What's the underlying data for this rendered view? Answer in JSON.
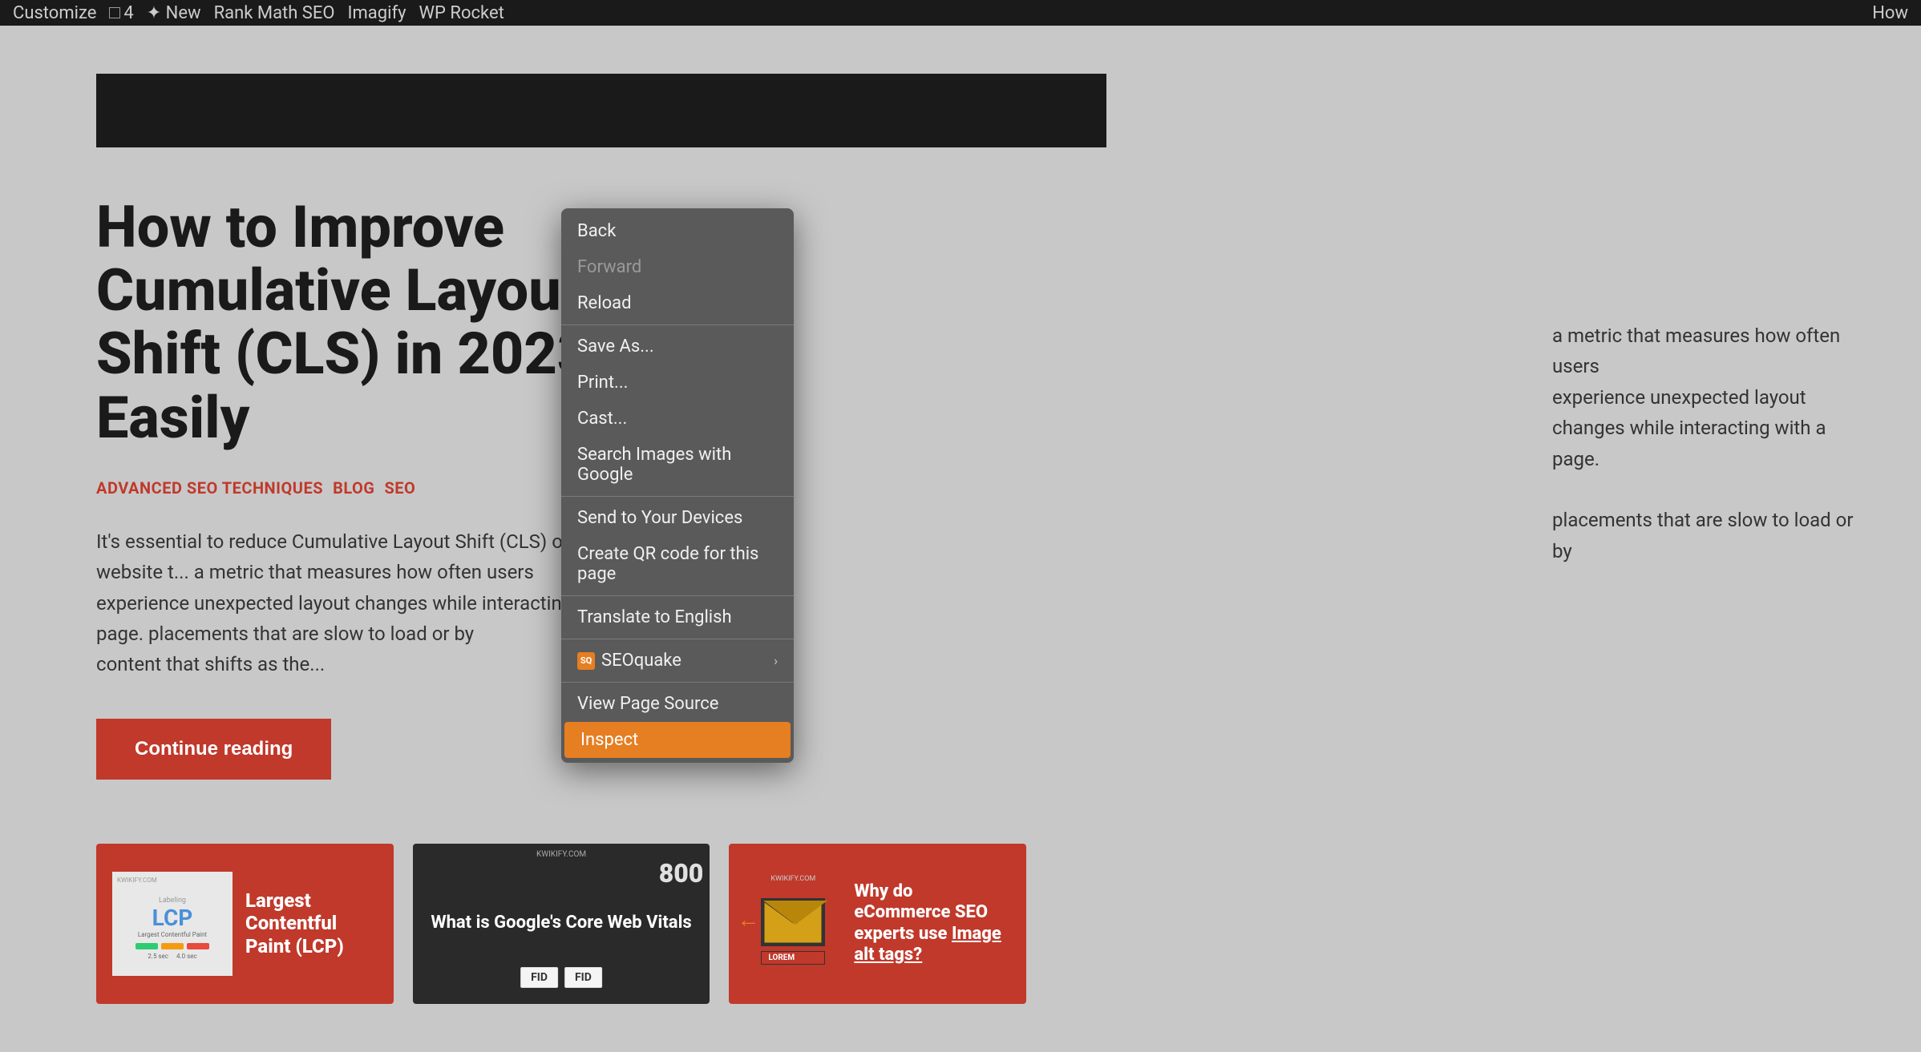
{
  "topbar": {
    "items": [
      "Customize",
      "4",
      "New",
      "Rank Math SEO",
      "Imagify",
      "WP Rocket",
      "How"
    ]
  },
  "article": {
    "title": "How to Improve Cumulative Layout Shift (CLS) in 2023 Easily",
    "tags": [
      "ADVANCED SEO TECHNIQUES",
      "BLOG",
      "SEO"
    ],
    "excerpt": "It's essential to reduce Cumulative Layout Shift (CLS) on your website t... a metric that measures how often users experience unexpected layout changes while interacting with a page... placements that are slow to load or by content that shifts as the...",
    "excerpt_short": "It's essential to reduce Cumulative Layout Shift (CLS) on your website t...",
    "excerpt_mid": "a metric that measures how often users experience unexpected layout changes while interacting with a page...",
    "excerpt_end": "placements that are slow to load or by content that shifts as the...",
    "continue_button": "Continue reading"
  },
  "context_menu": {
    "items": [
      {
        "label": "Back",
        "disabled": false,
        "has_submenu": false,
        "highlighted": false
      },
      {
        "label": "Forward",
        "disabled": true,
        "has_submenu": false,
        "highlighted": false
      },
      {
        "label": "Reload",
        "disabled": false,
        "has_submenu": false,
        "highlighted": false
      },
      {
        "label": "Save As...",
        "disabled": false,
        "has_submenu": false,
        "highlighted": false
      },
      {
        "label": "Print...",
        "disabled": false,
        "has_submenu": false,
        "highlighted": false
      },
      {
        "label": "Cast...",
        "disabled": false,
        "has_submenu": false,
        "highlighted": false
      },
      {
        "label": "Search Images with Google",
        "disabled": false,
        "has_submenu": false,
        "highlighted": false
      },
      {
        "label": "Send to Your Devices",
        "disabled": false,
        "has_submenu": false,
        "highlighted": false
      },
      {
        "label": "Create QR code for this page",
        "disabled": false,
        "has_submenu": false,
        "highlighted": false
      },
      {
        "label": "Translate to English",
        "disabled": false,
        "has_submenu": false,
        "highlighted": false
      },
      {
        "label": "SEOquake",
        "disabled": false,
        "has_submenu": true,
        "highlighted": false,
        "has_icon": true
      },
      {
        "label": "View Page Source",
        "disabled": false,
        "has_submenu": false,
        "highlighted": false
      },
      {
        "label": "Inspect",
        "disabled": false,
        "has_submenu": false,
        "highlighted": true
      }
    ]
  },
  "cards": [
    {
      "id": "lcp-card",
      "type": "lcp",
      "title": "Largest Contentful Paint (LCP)",
      "lcp_text": "LCP",
      "sublabel": "Largest Contentful Paint",
      "bar_colors": [
        "#2ecc71",
        "#f39c12",
        "#e74c3c"
      ],
      "bar_labels": [
        "2.5 sec",
        "4.0 sec"
      ]
    },
    {
      "id": "core-web-vitals-card",
      "type": "dark",
      "title": "What is Google's Core Web Vitals",
      "number_overlay": "800",
      "fid_label1": "FID",
      "fid_label2": "FID"
    },
    {
      "id": "alt-tags-card",
      "type": "ecommerce",
      "title": "Why do eCommerce SEO experts use Image alt tags?",
      "lorem_text": "LOREM"
    }
  ],
  "colors": {
    "primary_red": "#c0392b",
    "orange_arrow": "#e67e22",
    "menu_bg": "#5a5a5a",
    "menu_highlight": "#e67e22",
    "page_bg": "#c8c8c8"
  }
}
